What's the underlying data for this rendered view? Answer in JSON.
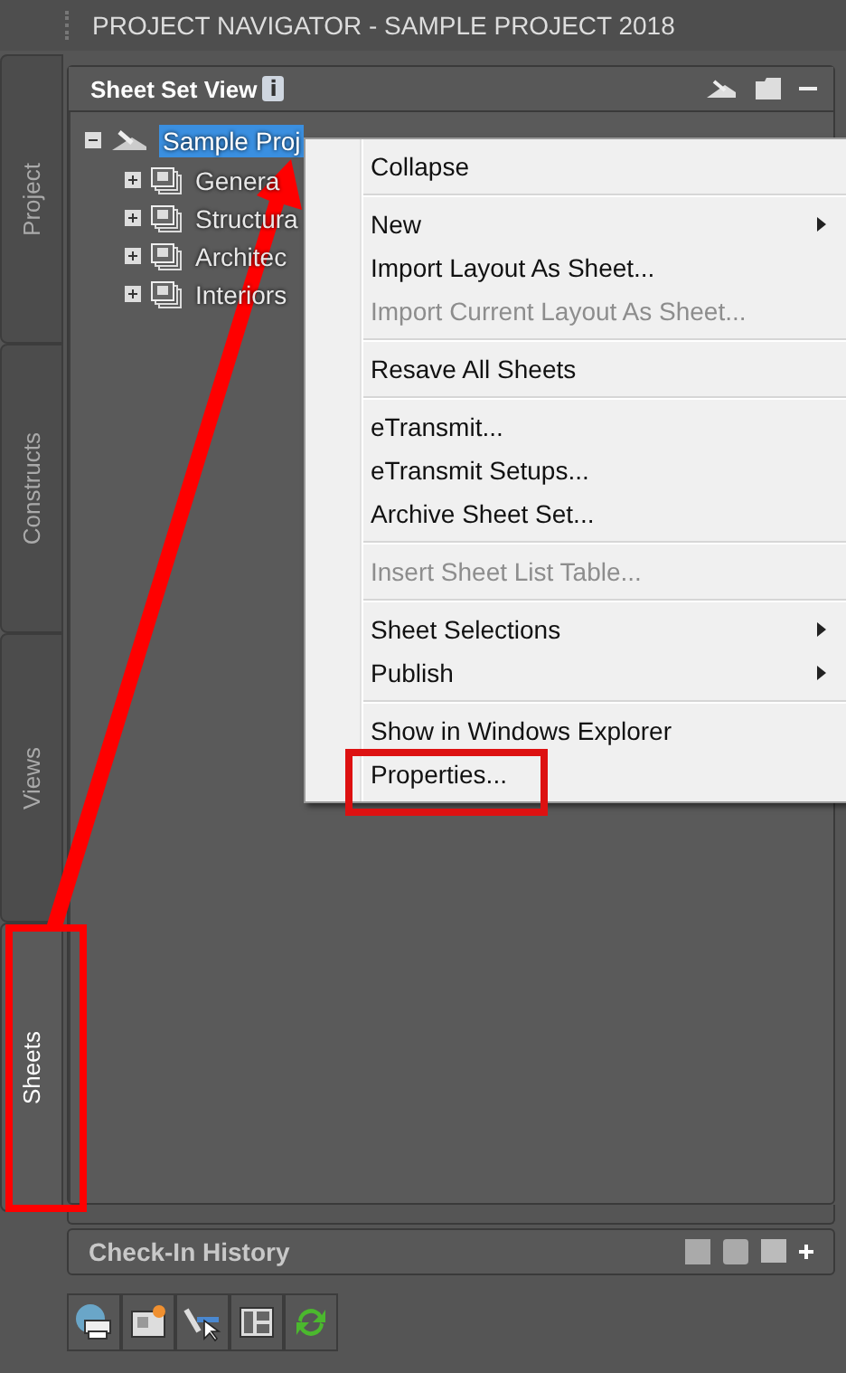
{
  "window": {
    "title": "PROJECT NAVIGATOR - SAMPLE PROJECT 2018"
  },
  "side_tabs": [
    {
      "label": "Project",
      "selected": false
    },
    {
      "label": "Constructs",
      "selected": false
    },
    {
      "label": "Views",
      "selected": false
    },
    {
      "label": "Sheets",
      "selected": true
    }
  ],
  "panel": {
    "title": "Sheet Set View",
    "info_badge": "i"
  },
  "tree": [
    {
      "label": "Sample Proj",
      "selected": true,
      "expanded": true,
      "children": [
        {
          "label": "Genera",
          "selected": false,
          "expanded": false
        },
        {
          "label": "Structura",
          "selected": false,
          "expanded": false
        },
        {
          "label": "Architec",
          "selected": false,
          "expanded": false
        },
        {
          "label": "Interiors",
          "selected": false,
          "expanded": false
        }
      ]
    }
  ],
  "context_menu": [
    {
      "kind": "item",
      "label": "Collapse",
      "disabled": false,
      "submenu": false
    },
    {
      "kind": "separator"
    },
    {
      "kind": "item",
      "label": "New",
      "disabled": false,
      "submenu": true
    },
    {
      "kind": "item",
      "label": "Import Layout As Sheet...",
      "disabled": false,
      "submenu": false
    },
    {
      "kind": "item",
      "label": "Import Current Layout As Sheet...",
      "disabled": true,
      "submenu": false
    },
    {
      "kind": "separator"
    },
    {
      "kind": "item",
      "label": "Resave All Sheets",
      "disabled": false,
      "submenu": false
    },
    {
      "kind": "separator"
    },
    {
      "kind": "item",
      "label": "eTransmit...",
      "disabled": false,
      "submenu": false
    },
    {
      "kind": "item",
      "label": "eTransmit Setups...",
      "disabled": false,
      "submenu": false
    },
    {
      "kind": "item",
      "label": "Archive Sheet Set...",
      "disabled": false,
      "submenu": false
    },
    {
      "kind": "separator"
    },
    {
      "kind": "item",
      "label": "Insert Sheet List Table...",
      "disabled": true,
      "submenu": false
    },
    {
      "kind": "separator"
    },
    {
      "kind": "item",
      "label": "Sheet Selections",
      "disabled": false,
      "submenu": true
    },
    {
      "kind": "item",
      "label": "Publish",
      "disabled": false,
      "submenu": true
    },
    {
      "kind": "separator"
    },
    {
      "kind": "item",
      "label": "Show in Windows Explorer",
      "disabled": false,
      "submenu": false
    },
    {
      "kind": "item",
      "label": "Properties...",
      "disabled": false,
      "submenu": false
    }
  ],
  "check_in_history": {
    "title": "Check-In History"
  }
}
